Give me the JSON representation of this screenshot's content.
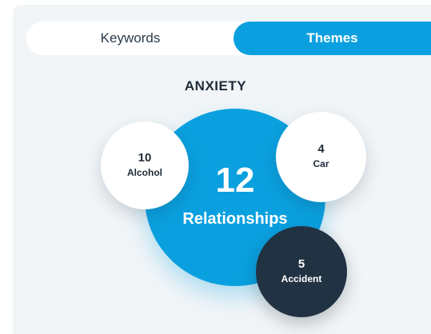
{
  "tabs": {
    "keywords_label": "Keywords",
    "themes_label": "Themes",
    "active": "Themes"
  },
  "theme": {
    "title": "ANXIETY",
    "main": {
      "count": "12",
      "label": "Relationships"
    },
    "related": [
      {
        "count": "10",
        "label": "Alcohol"
      },
      {
        "count": "4",
        "label": "Car"
      },
      {
        "count": "5",
        "label": "Accident"
      }
    ]
  },
  "colors": {
    "accent": "#0aa0df",
    "dark": "#213243",
    "panel_background": "#f1f5f8",
    "text": "#1f2b38"
  }
}
